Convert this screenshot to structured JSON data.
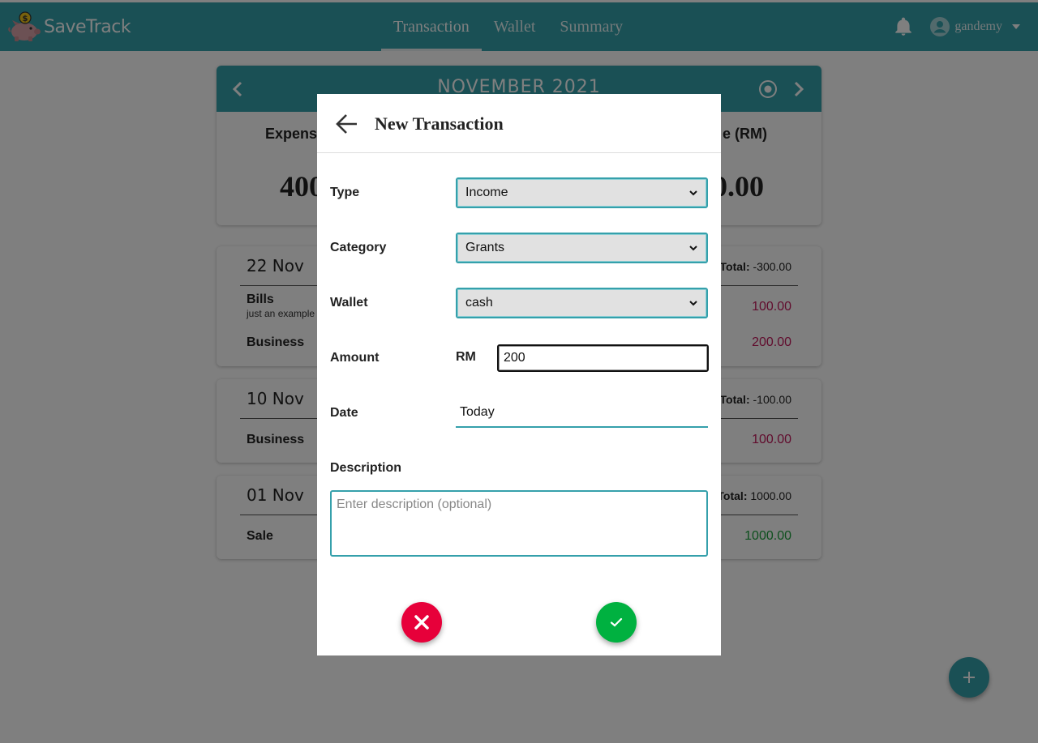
{
  "app": {
    "name": "SaveTrack"
  },
  "nav": {
    "links": [
      "Transaction",
      "Wallet",
      "Summary"
    ],
    "active": "Transaction",
    "username": "gandemy"
  },
  "month": {
    "title": "NOVEMBER 2021",
    "expense_label": "Expens",
    "expense_value": "400",
    "balance_label": "e (RM)",
    "balance_value": ".0.00"
  },
  "days": [
    {
      "date": "22 Nov",
      "total_label": "Total:",
      "total_value": "-300.00",
      "items": [
        {
          "category": "Bills",
          "note": "just an example",
          "amount": "100.00",
          "sign": "neg"
        },
        {
          "category": "Business",
          "note": "",
          "amount": "200.00",
          "sign": "neg"
        }
      ]
    },
    {
      "date": "10 Nov",
      "total_label": "Total:",
      "total_value": "-100.00",
      "items": [
        {
          "category": "Business",
          "note": "",
          "amount": "100.00",
          "sign": "neg"
        }
      ]
    },
    {
      "date": "01 Nov",
      "total_label": "Total:",
      "total_value": "1000.00",
      "items": [
        {
          "category": "Sale",
          "note": "",
          "amount": "1000.00",
          "sign": "pos"
        }
      ]
    }
  ],
  "modal": {
    "title": "New Transaction",
    "type_label": "Type",
    "type_value": "Income",
    "category_label": "Category",
    "category_value": "Grants",
    "wallet_label": "Wallet",
    "wallet_value": "cash",
    "amount_label": "Amount",
    "currency": "RM",
    "amount_value": "200",
    "date_label": "Date",
    "date_value": "Today",
    "description_label": "Description",
    "description_placeholder": "Enter description (optional)"
  },
  "colors": {
    "brand": "#35a0ab",
    "cancel": "#e7003a",
    "confirm": "#00b140",
    "negative": "#c2185b",
    "positive": "#1a9e3a"
  },
  "icons": [
    "piggy-bank-logo",
    "bell-icon",
    "user-avatar-icon",
    "chevron-down-icon",
    "chevron-left-icon",
    "chevron-right-icon",
    "target-icon",
    "arrow-left-icon",
    "close-icon",
    "check-icon",
    "plus-icon"
  ]
}
